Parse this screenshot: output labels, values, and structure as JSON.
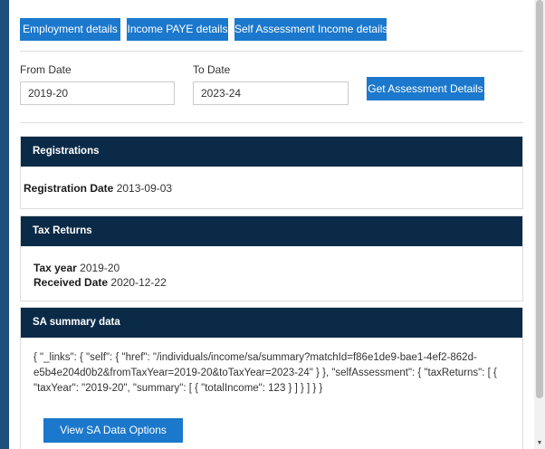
{
  "tabs": {
    "employment": "Employment details",
    "paye": "Income PAYE details",
    "self_assessment": "Self Assessment Income details"
  },
  "filters": {
    "from_label": "From Date",
    "from_value": "2019-20",
    "to_label": "To Date",
    "to_value": "2023-24",
    "submit_label": "Get Assessment Details"
  },
  "registrations": {
    "title": "Registrations",
    "date_label": "Registration Date",
    "date_value": "2013-09-03"
  },
  "tax_returns": {
    "title": "Tax Returns",
    "year_label": "Tax year",
    "year_value": "2019-20",
    "received_label": "Received Date",
    "received_value": "2020-12-22"
  },
  "sa_summary": {
    "title": "SA summary data",
    "json_text": "{ \"_links\": { \"self\": { \"href\": \"/individuals/income/sa/summary?matchId=f86e1de9-bae1-4ef2-862d-e5b4e204d0b2&fromTaxYear=2019-20&toTaxYear=2023-24\" } }, \"selfAssessment\": { \"taxReturns\": [ { \"taxYear\": \"2019-20\", \"summary\": [ { \"totalIncome\": 123 } ] } ] } }",
    "options_label": "View SA Data Options"
  },
  "colors": {
    "primary_button": "#1b78cc",
    "panel_header": "#0b2a47",
    "left_strip": "#1d4f7c"
  }
}
